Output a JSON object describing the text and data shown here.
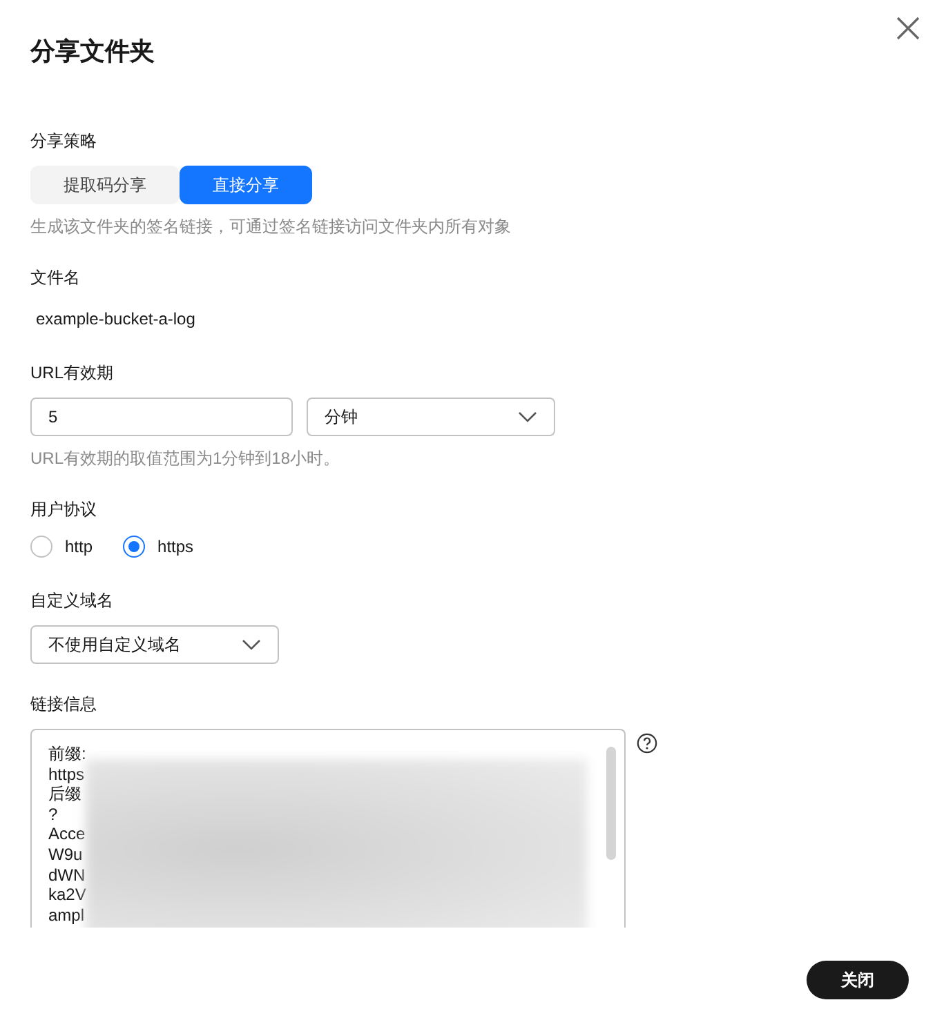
{
  "dialog": {
    "title": "分享文件夹"
  },
  "share_strategy": {
    "label": "分享策略",
    "options": [
      {
        "label": "提取码分享",
        "selected": false
      },
      {
        "label": "直接分享",
        "selected": true
      }
    ],
    "hint": "生成该文件夹的签名链接，可通过签名链接访问文件夹内所有对象"
  },
  "file_name": {
    "label": "文件名",
    "value": "example-bucket-a-log"
  },
  "url_validity": {
    "label": "URL有效期",
    "value": "5",
    "unit": "分钟",
    "hint": "URL有效期的取值范围为1分钟到18小时。"
  },
  "protocol": {
    "label": "用户协议",
    "options": [
      {
        "label": "http",
        "selected": false
      },
      {
        "label": "https",
        "selected": true
      }
    ]
  },
  "custom_domain": {
    "label": "自定义域名",
    "value": "不使用自定义域名"
  },
  "link_info": {
    "label": "链接信息",
    "lines": [
      "前缀:",
      "https",
      "后缀",
      "?",
      "Acce",
      "W9u",
      "dWN",
      "ka2V",
      "ampl"
    ]
  },
  "buttons": [
    {
      "label": "关闭"
    }
  ]
}
